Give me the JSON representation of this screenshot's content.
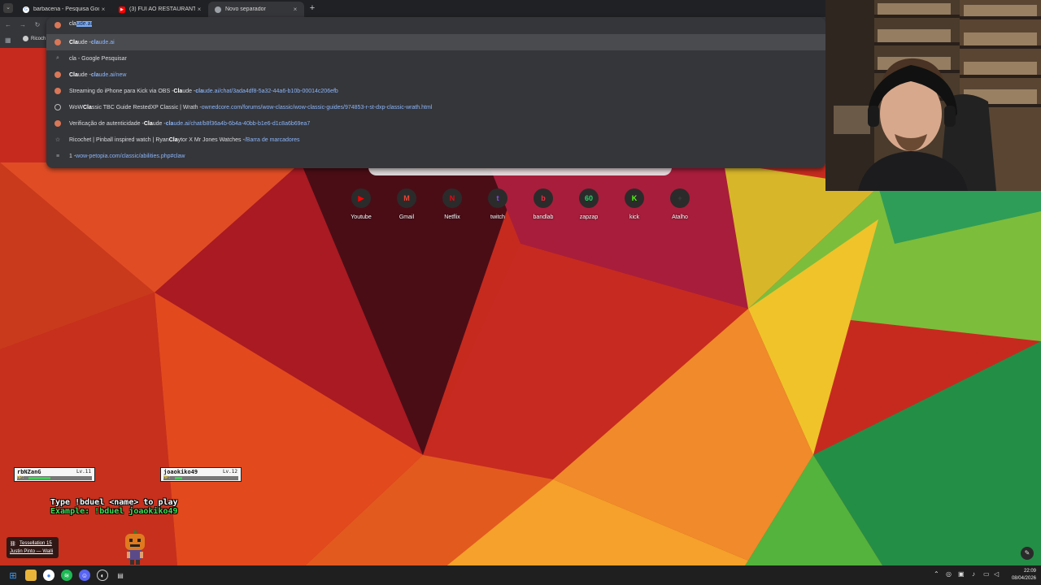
{
  "tabs": [
    {
      "title": "barbacena - Pesquisa Google",
      "favicon": "google-icon",
      "active": false
    },
    {
      "title": "(3) FUI AO RESTAURANTE DO C",
      "favicon": "youtube-icon",
      "active": false
    },
    {
      "title": "Novo separador",
      "favicon": "chrome-icon",
      "active": true
    }
  ],
  "tab_close": "×",
  "new_tab": "+",
  "bookmark_bar": {
    "item": "Ricoch"
  },
  "omnibox": {
    "typed": "cla",
    "completion": "ude.ai",
    "suggestions": [
      {
        "icon": "claude-icon",
        "pre": "",
        "bold": "Cla",
        "text": "ude - ",
        "url_bold": "cla",
        "url": "ude.ai"
      },
      {
        "icon": "search-icon",
        "pre": "cla - Google Pesquisar",
        "bold": "",
        "text": "",
        "url_bold": "",
        "url": ""
      },
      {
        "icon": "claude-icon",
        "pre": "",
        "bold": "Cla",
        "text": "ude - ",
        "url_bold": "cla",
        "url": "ude.ai/new"
      },
      {
        "icon": "claude-icon",
        "pre": "Streaming do iPhone para Kick via OBS - ",
        "bold": "Cla",
        "text": "ude - ",
        "url_bold": "cla",
        "url": "ude.ai/chat/3ada4df8-5a32-44a6-b10b-00014c206efb"
      },
      {
        "icon": "globe-icon",
        "pre": "WoW ",
        "bold": "Cla",
        "text": "ssic TBC Guide RestedXP Classic | Wrath - ",
        "url_bold": "",
        "url": "ownedcore.com/forums/wow-classic/wow-classic-guides/974853-r-st-dxp-classic-wrath.html"
      },
      {
        "icon": "claude-icon",
        "pre": "Verificação de autenticidade - ",
        "bold": "Cla",
        "text": "ude - ",
        "url_bold": "cla",
        "url": "ude.ai/chat/b8f36a4b-6b4a-40bb-b1e6-d1c8a6b69ea7"
      },
      {
        "icon": "star-icon",
        "pre": "Ricochet | Pinball inspired watch | Ryan ",
        "bold": "Cla",
        "text": "ytor X Mr Jones Watches - ",
        "url_bold": "",
        "url": "/Barra de marcadores"
      },
      {
        "icon": "history-icon",
        "pre": "1 - ",
        "bold": "",
        "text": "",
        "url_bold": "",
        "url": "wow-petopia.com/classic/abilities.php#claw"
      }
    ]
  },
  "shortcuts": [
    {
      "label": "Youtube",
      "glyph": "▶",
      "color": "#ff0000"
    },
    {
      "label": "Gmail",
      "glyph": "M",
      "color": "#ea4335"
    },
    {
      "label": "Netflix",
      "glyph": "N",
      "color": "#e50914"
    },
    {
      "label": "twitch",
      "glyph": "t",
      "color": "#9146ff"
    },
    {
      "label": "bandlab",
      "glyph": "b",
      "color": "#f12c3f"
    },
    {
      "label": "zapzap",
      "glyph": "60",
      "color": "#25d366"
    },
    {
      "label": "kick",
      "glyph": "K",
      "color": "#53fc18"
    },
    {
      "label": "Atalho",
      "glyph": "+",
      "color": "#3c3c3c"
    }
  ],
  "players": [
    {
      "name": "rbNZanG",
      "level": "Lv.11",
      "hp_label": "HP:",
      "hp_fraction": 0.35
    },
    {
      "name": "joaokiko49",
      "level": "Lv.12",
      "hp_label": "HP:",
      "hp_fraction": 0.12
    }
  ],
  "game_message": {
    "line1": "Type !bduel <name> to play",
    "line2": "Example: !bduel joaokiko49"
  },
  "music": {
    "title": "Tessellation 15",
    "artist": "Justin Pinto — Walli"
  },
  "clock": {
    "time": "22:09",
    "date": "08/04/2026"
  }
}
